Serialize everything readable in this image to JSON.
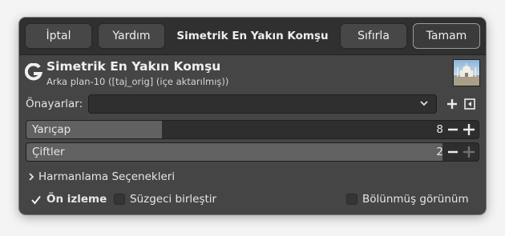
{
  "header": {
    "cancel_label": "İptal",
    "help_label": "Yardım",
    "title": "Simetrik En Yakın Komşu",
    "reset_label": "Sıfırla",
    "ok_label": "Tamam"
  },
  "procedure": {
    "title": "Simetrik En Yakın Komşu",
    "subtitle": "Arka plan-10 ([taj_orig] (içe aktarılmış))",
    "logo_icon": "gimp-logo-icon",
    "thumbnail_icon": "image-thumbnail-icon"
  },
  "presets": {
    "label": "Önayarlar:",
    "value": "",
    "add_icon": "plus-icon",
    "menu_icon": "preset-menu-icon"
  },
  "params": [
    {
      "label": "Yarıçap",
      "value": "8",
      "fill_fraction": 0.3,
      "plus_enabled": true
    },
    {
      "label": "Çiftler",
      "value": "2",
      "fill_fraction": 0.92,
      "plus_enabled": false
    }
  ],
  "blending": {
    "label": "Harmanlama Seçenekleri",
    "expanded": false
  },
  "options": {
    "preview_label": "Ön izleme",
    "preview_checked": true,
    "merge_label": "Süzgeci birleştir",
    "merge_checked": false,
    "split_label": "Bölünmüş görünüm",
    "split_checked": false
  },
  "colors": {
    "window_bg": "#454545",
    "header_bg": "#303030",
    "slider_fill": "#616161",
    "text": "#e6e6e6"
  }
}
